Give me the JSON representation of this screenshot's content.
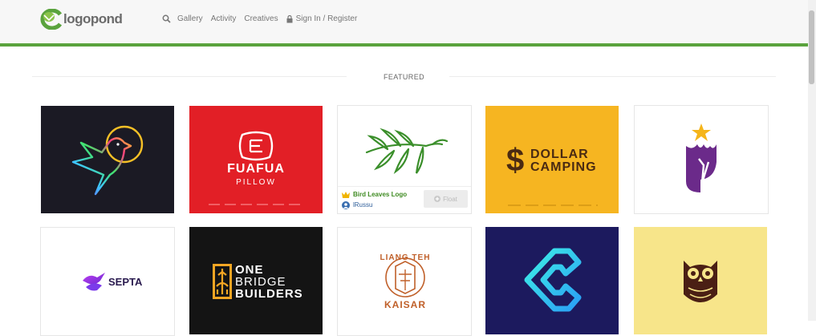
{
  "brand": {
    "name": "logopond",
    "accent_green": "#5aa33d",
    "logo_mark_color": "#8bc34a"
  },
  "nav": {
    "gallery": "Gallery",
    "activity": "Activity",
    "creatives": "Creatives",
    "signin": "Sign In / Register"
  },
  "section": {
    "featured": "FEATURED"
  },
  "cards": [
    {
      "bg": "#1b1a24"
    },
    {
      "bg": "#e21f26",
      "line1": "FUAFUA",
      "line2": "PILLOW"
    },
    {
      "bg": "#ffffff",
      "hover_title": "Bird Leaves Logo",
      "hover_user": "lRussu",
      "float_label": "Float"
    },
    {
      "bg": "#f6b521",
      "line1": "DOLLAR",
      "line2": "CAMPING"
    },
    {
      "bg": "#ffffff"
    },
    {
      "bg": "#ffffff",
      "text": "SEPTA"
    },
    {
      "bg": "#141414",
      "line1": "ONE",
      "line2": "BRIDGE",
      "line3": "BUILDERS"
    },
    {
      "bg": "#ffffff",
      "top": "LIANG TEH",
      "bottom": "KAISAR"
    },
    {
      "bg": "#1c1a5e"
    },
    {
      "bg": "#f7e58a"
    }
  ]
}
